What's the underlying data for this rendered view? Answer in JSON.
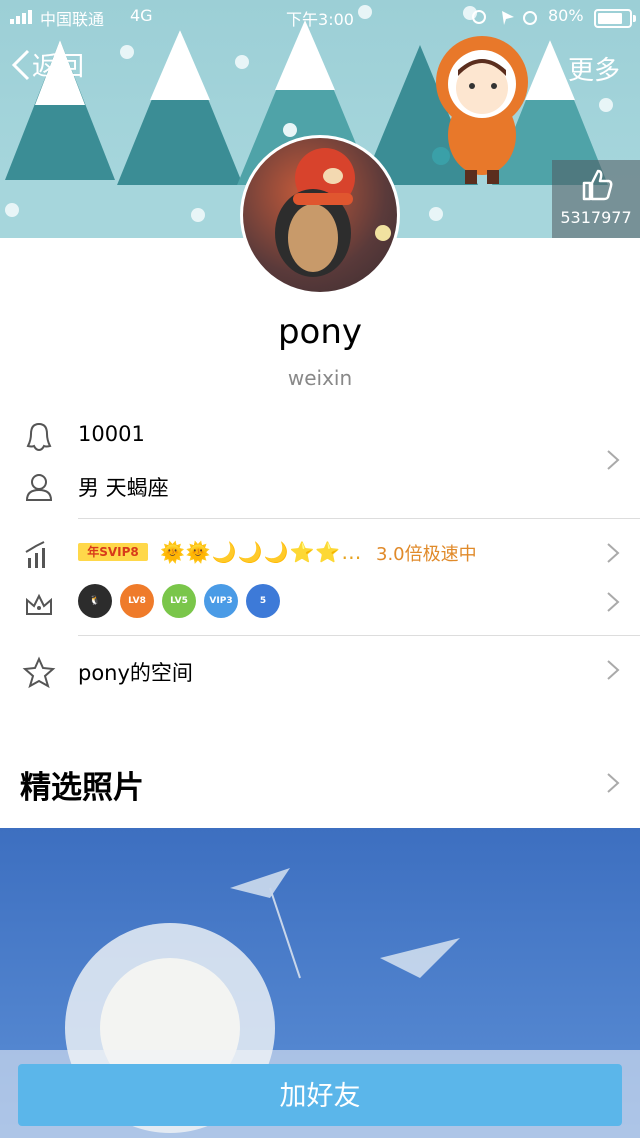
{
  "status_bar": {
    "carrier": "中国联通",
    "network": "4G",
    "time": "下午3:00",
    "battery": "80%"
  },
  "nav": {
    "back_label": "返回",
    "more_label": "更多"
  },
  "likes": {
    "count": "5317977",
    "icon": "thumbs-up-icon"
  },
  "profile": {
    "name": "pony",
    "nickname": "weixin"
  },
  "info": {
    "qq_number": "10001",
    "gender_sign": "男 天蝎座",
    "svip_badge": "年SVIP8",
    "level_icons": "🌞🌞🌙🌙🌙⭐⭐…",
    "speed_text": "3.0倍极速中",
    "vip_icons": [
      "LV8",
      "LV5",
      "VIP3",
      "5"
    ],
    "qzone_label": "pony的空间"
  },
  "section": {
    "photos_title": "精选照片"
  },
  "action": {
    "add_friend_label": "加好友"
  },
  "colors": {
    "accent": "#5bb6ea",
    "speed": "#e08a2a",
    "header_bg": "#9ccfd6"
  }
}
